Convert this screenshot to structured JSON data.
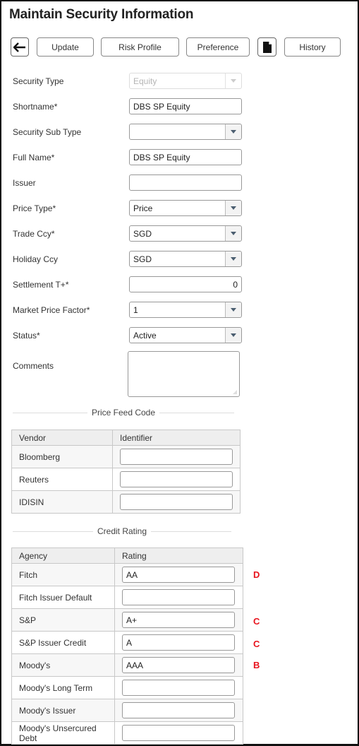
{
  "page": {
    "title": "Maintain Security Information"
  },
  "toolbar": {
    "back_icon": "arrow-left-icon",
    "update_label": "Update",
    "risk_profile_label": "Risk Profile",
    "preference_label": "Preference",
    "document_icon": "document-icon",
    "history_label": "History"
  },
  "form": {
    "security_type": {
      "label": "Security Type",
      "value": "Equity",
      "disabled": true
    },
    "shortname": {
      "label": "Shortname*",
      "value": "DBS SP Equity"
    },
    "security_sub_type": {
      "label": "Security Sub Type",
      "value": ""
    },
    "full_name": {
      "label": "Full Name*",
      "value": "DBS SP Equity"
    },
    "issuer": {
      "label": "Issuer",
      "value": ""
    },
    "price_type": {
      "label": "Price Type*",
      "value": "Price"
    },
    "trade_ccy": {
      "label": "Trade Ccy*",
      "value": "SGD"
    },
    "holiday_ccy": {
      "label": "Holiday Ccy",
      "value": "SGD"
    },
    "settlement": {
      "label": "Settlement T+*",
      "value": "0"
    },
    "market_price_factor": {
      "label": "Market Price Factor*",
      "value": "1"
    },
    "status": {
      "label": "Status*",
      "value": "Active"
    },
    "comments": {
      "label": "Comments",
      "value": ""
    }
  },
  "price_feed": {
    "title": "Price Feed Code",
    "headers": [
      "Vendor",
      "Identifier"
    ],
    "rows": [
      {
        "vendor": "Bloomberg",
        "identifier": ""
      },
      {
        "vendor": "Reuters",
        "identifier": ""
      },
      {
        "vendor": "IDISIN",
        "identifier": ""
      }
    ]
  },
  "credit_rating": {
    "title": "Credit Rating",
    "headers": [
      "Agency",
      "Rating"
    ],
    "rows": [
      {
        "agency": "Fitch",
        "rating": "AA",
        "annotation": "D"
      },
      {
        "agency": "Fitch Issuer Default",
        "rating": "",
        "annotation": ""
      },
      {
        "agency": "S&P",
        "rating": "A+",
        "annotation": "C"
      },
      {
        "agency": "S&P Issuer Credit",
        "rating": "A",
        "annotation": "C"
      },
      {
        "agency": "Moody's",
        "rating": "AAA",
        "annotation": "B"
      },
      {
        "agency": "Moody's Long Term",
        "rating": "",
        "annotation": ""
      },
      {
        "agency": "Moody's Issuer",
        "rating": "",
        "annotation": ""
      },
      {
        "agency": "Moody's Unsercured Debt",
        "rating": "",
        "annotation": ""
      }
    ]
  },
  "colors": {
    "annotation": "#e8141e",
    "dropdown_arrow": "#4b5e70"
  }
}
